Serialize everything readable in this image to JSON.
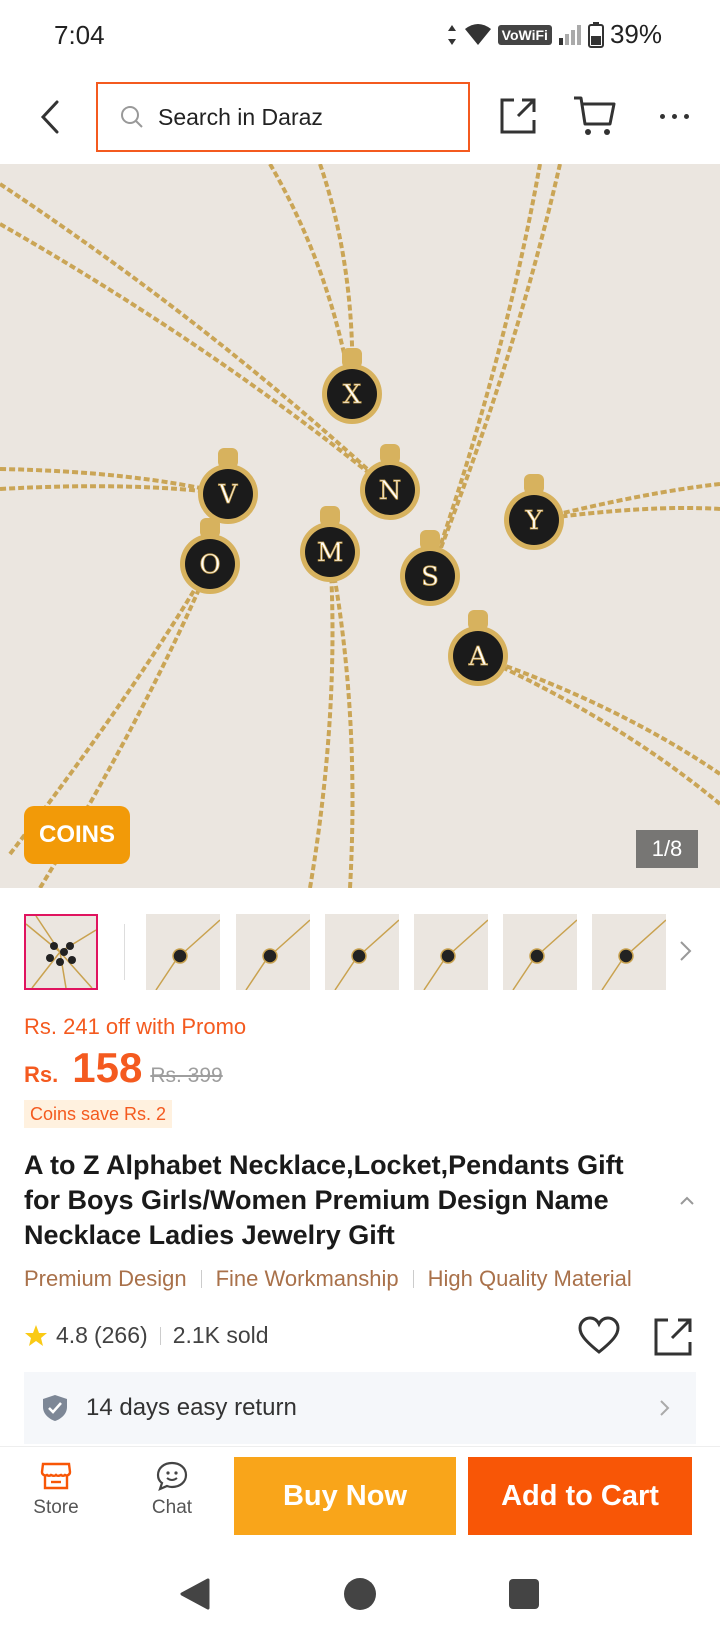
{
  "status_bar": {
    "time": "7:04",
    "network_label": "VoWiFi",
    "battery": "39%"
  },
  "header": {
    "search_placeholder": "Search in Daraz",
    "icons": [
      "back-arrow-icon",
      "search-icon",
      "share-icon",
      "cart-icon",
      "more-icon"
    ]
  },
  "gallery": {
    "badge": "COINS",
    "page_indicator": "1/8",
    "pendant_letters": [
      "X",
      "V",
      "N",
      "Y",
      "O",
      "M",
      "S",
      "A"
    ],
    "thumbnail_count": 7
  },
  "pricing": {
    "promo_text": "Rs. 241 off with Promo",
    "currency": "Rs.",
    "price": "158",
    "original_price": "Rs. 399",
    "coins_save": "Coins save Rs. 2"
  },
  "product": {
    "title": "A to Z Alphabet Necklace,Locket,Pendants Gift for Boys Girls/Women Premium Design Name Necklace Ladies Jewelry Gift",
    "tags": [
      "Premium Design",
      "Fine Workmanship",
      "High Quality Material"
    ],
    "rating": "4.8",
    "reviews": "(266)",
    "sold": "2.1K sold"
  },
  "return_policy": {
    "text": "14 days easy return"
  },
  "action_bar": {
    "store_label": "Store",
    "chat_label": "Chat",
    "buy_now_label": "Buy Now",
    "add_to_cart_label": "Add to Cart"
  },
  "colors": {
    "accent_orange": "#f85606",
    "buy_now_yellow": "#f9a51a",
    "coins_badge": "#f29a08",
    "tag_brown": "#a9714a",
    "active_thumb_border": "#e0145f"
  }
}
